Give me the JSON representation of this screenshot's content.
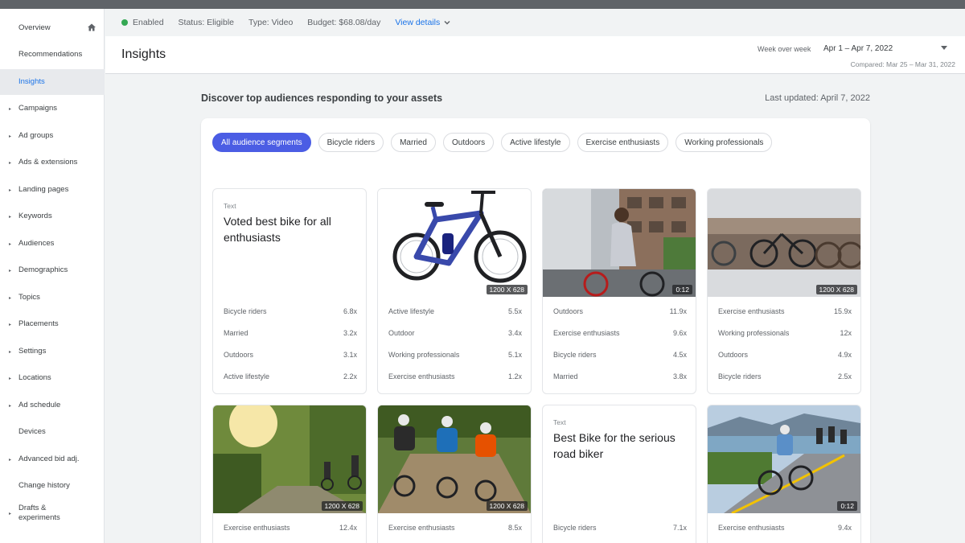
{
  "sidebar": {
    "items": [
      {
        "label": "Overview",
        "chevron": false,
        "home": true
      },
      {
        "label": "Recommendations",
        "chevron": false
      },
      {
        "label": "Insights",
        "chevron": false,
        "active": true
      },
      {
        "label": "Campaigns",
        "chevron": true
      },
      {
        "label": "Ad groups",
        "chevron": true
      },
      {
        "label": "Ads & extensions",
        "chevron": true
      },
      {
        "label": "Landing pages",
        "chevron": true
      },
      {
        "label": "Keywords",
        "chevron": true
      },
      {
        "label": "Audiences",
        "chevron": true
      },
      {
        "label": "Demographics",
        "chevron": true
      },
      {
        "label": "Topics",
        "chevron": true
      },
      {
        "label": "Placements",
        "chevron": true
      },
      {
        "label": "Settings",
        "chevron": true
      },
      {
        "label": "Locations",
        "chevron": true
      },
      {
        "label": "Ad schedule",
        "chevron": true
      },
      {
        "label": "Devices",
        "chevron": false
      },
      {
        "label": "Advanced bid adj.",
        "chevron": true
      },
      {
        "label": "Change history",
        "chevron": false
      },
      {
        "label": "Drafts &",
        "label2": "experiments",
        "chevron": true
      }
    ]
  },
  "statusbar": {
    "enabled": "Enabled",
    "status": "Status: Eligible",
    "type": "Type: Video",
    "budget": "Budget: $68.08/day",
    "view_details": "View details"
  },
  "header": {
    "title": "Insights",
    "week_over_week": "Week over week",
    "range": "Apr 1 – Apr 7, 2022",
    "compared": "Compared: Mar 25 – Mar 31, 2022"
  },
  "main": {
    "subhead": "Discover top audiences responding to your assets",
    "last_updated": "Last updated: April 7, 2022",
    "chips": [
      "All audience segments",
      "Bicycle riders",
      "Married",
      "Outdoors",
      "Active lifestyle",
      "Exercise enthusiasts",
      "Working professionals"
    ]
  },
  "cards": [
    {
      "kind": "text",
      "tag": "Text",
      "text": "Voted best bike for all enthusiasts",
      "metrics": [
        [
          "Bicycle riders",
          "6.8x"
        ],
        [
          "Married",
          "3.2x"
        ],
        [
          "Outdoors",
          "3.1x"
        ],
        [
          "Active lifestyle",
          "2.2x"
        ]
      ]
    },
    {
      "kind": "image",
      "image": "blue-mountain-bike",
      "dim": "1200 X 628",
      "metrics": [
        [
          "Active lifestyle",
          "5.5x"
        ],
        [
          "Outdoor",
          "3.4x"
        ],
        [
          "Working professionals",
          "5.1x"
        ],
        [
          "Exercise enthusiasts",
          "1.2x"
        ]
      ]
    },
    {
      "kind": "image",
      "image": "woman-cycling-city",
      "dim": "0:12",
      "metrics": [
        [
          "Outdoors",
          "11.9x"
        ],
        [
          "Exercise enthusiasts",
          "9.6x"
        ],
        [
          "Bicycle riders",
          "4.5x"
        ],
        [
          "Married",
          "3.8x"
        ]
      ]
    },
    {
      "kind": "image",
      "image": "parked-bicycles",
      "dim": "1200 X 628",
      "metrics": [
        [
          "Exercise enthusiasts",
          "15.9x"
        ],
        [
          "Working professionals",
          "12x"
        ],
        [
          "Outdoors",
          "4.9x"
        ],
        [
          "Bicycle riders",
          "2.5x"
        ]
      ]
    },
    {
      "kind": "image",
      "image": "sunset-forest-riders",
      "dim": "1200 X 628",
      "metrics": [
        [
          "Exercise enthusiasts",
          "12.4x"
        ]
      ]
    },
    {
      "kind": "image",
      "image": "three-mountain-bikers",
      "dim": "1200 X 628",
      "metrics": [
        [
          "Exercise enthusiasts",
          "8.5x"
        ]
      ]
    },
    {
      "kind": "text",
      "tag": "Text",
      "text": "Best Bike for the serious road biker",
      "metrics": [
        [
          "Bicycle riders",
          "7.1x"
        ]
      ]
    },
    {
      "kind": "image",
      "image": "lakeside-road-cyclists",
      "dim": "0:12",
      "metrics": [
        [
          "Exercise enthusiasts",
          "9.4x"
        ]
      ]
    }
  ]
}
